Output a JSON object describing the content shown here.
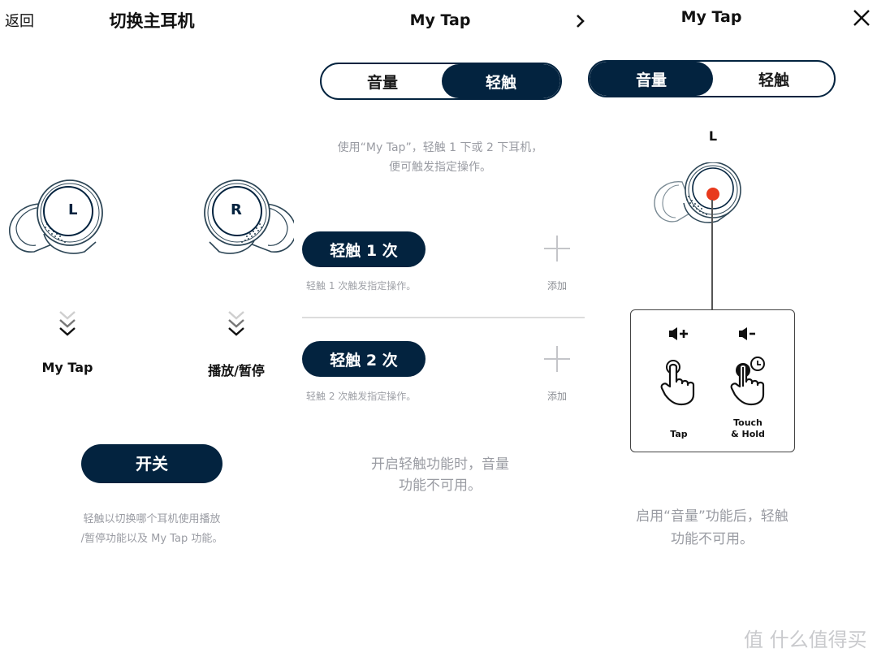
{
  "panels": {
    "switch_primary": {
      "back_label": "返回",
      "title": "切换主耳机",
      "left_bud_letter": "L",
      "right_bud_letter": "R",
      "left_function": "My Tap",
      "right_function": "播放/暂停",
      "switch_button": "开关",
      "hint_line1": "轻触以切换哪个耳机使用播放",
      "hint_line2": "/暂停功能以及 My Tap 功能。"
    },
    "my_tap_touch": {
      "title": "My Tap",
      "segments": [
        {
          "label": "音量",
          "active": false
        },
        {
          "label": "轻触",
          "active": true
        }
      ],
      "intro_line1": "使用“My Tap”，轻触 1 下或 2 下耳机，",
      "intro_line2": "便可触发指定操作。",
      "actions": [
        {
          "button": "轻触 1 次",
          "description": "轻触 1 次触发指定操作。",
          "add_label": "添加"
        },
        {
          "button": "轻触 2 次",
          "description": "轻触 2 次触发指定操作。",
          "add_label": "添加"
        }
      ],
      "note_line1": "开启轻触功能时，音量",
      "note_line2": "功能不可用。"
    },
    "my_tap_volume": {
      "title": "My Tap",
      "segments": [
        {
          "label": "音量",
          "active": true
        },
        {
          "label": "轻触",
          "active": false
        }
      ],
      "bud_label": "L",
      "gestures": [
        {
          "icon": "volume-up",
          "label": "Tap"
        },
        {
          "icon": "volume-down",
          "label_line1": "Touch",
          "label_line2": "& Hold"
        }
      ],
      "note_line1": "启用“音量”功能后，轻触",
      "note_line2": "功能不可用。"
    }
  },
  "watermark": "值 什么值得买",
  "colors": {
    "navy": "#03233f",
    "indicator_red": "#e8391c",
    "hint_gray": "#9a9ca3"
  }
}
